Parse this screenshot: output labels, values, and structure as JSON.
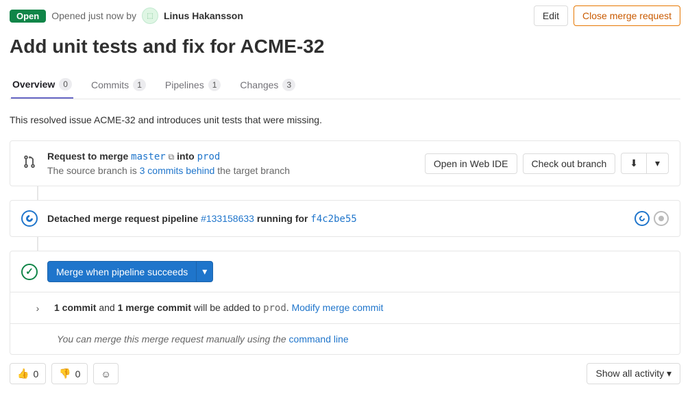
{
  "header": {
    "status": "Open",
    "opened_text": "Opened just now by",
    "author": "Linus Hakansson",
    "edit_label": "Edit",
    "close_label": "Close merge request"
  },
  "title": "Add unit tests and fix for ACME-32",
  "tabs": [
    {
      "label": "Overview",
      "count": "0"
    },
    {
      "label": "Commits",
      "count": "1"
    },
    {
      "label": "Pipelines",
      "count": "1"
    },
    {
      "label": "Changes",
      "count": "3"
    }
  ],
  "description": "This resolved issue ACME-32 and introduces unit tests that were missing.",
  "merge_widget": {
    "request_label": "Request to merge",
    "source_branch": "master",
    "into_label": "into",
    "target_branch": "prod",
    "sub_prefix": "The source branch is ",
    "sub_link": "3 commits behind",
    "sub_suffix": " the target branch",
    "open_ide_label": "Open in Web IDE",
    "checkout_label": "Check out branch"
  },
  "pipeline": {
    "prefix": "Detached merge request pipeline ",
    "id": "#133158633",
    "running_text": " running for ",
    "commit": "f4c2be55"
  },
  "merge_action": {
    "button_label": "Merge when pipeline succeeds"
  },
  "commit_info": {
    "one_commit": "1 commit",
    "and": " and ",
    "one_merge": "1 merge commit",
    "added_to": " will be added to ",
    "target": "prod",
    "period": ". ",
    "modify_link": "Modify merge commit"
  },
  "manual": {
    "prefix": "You can merge this merge request manually using the ",
    "link": "command line"
  },
  "reactions": {
    "thumbs_up": "0",
    "thumbs_down": "0"
  },
  "activity_filter": "Show all activity"
}
